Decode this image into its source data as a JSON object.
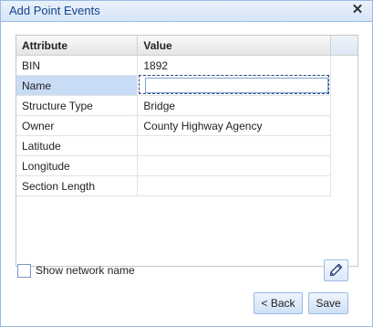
{
  "window": {
    "title": "Add Point Events",
    "close_glyph": "✕"
  },
  "grid": {
    "columns": [
      "Attribute",
      "Value"
    ],
    "rows": [
      {
        "attribute": "BIN",
        "value": "1892"
      },
      {
        "attribute": "Name",
        "value": ""
      },
      {
        "attribute": "Structure Type",
        "value": "Bridge"
      },
      {
        "attribute": "Owner",
        "value": "County Highway Agency"
      },
      {
        "attribute": "Latitude",
        "value": ""
      },
      {
        "attribute": "Longitude",
        "value": ""
      },
      {
        "attribute": "Section Length",
        "value": ""
      }
    ]
  },
  "options": {
    "show_network_name_label": "Show network name",
    "show_network_name_checked": false
  },
  "buttons": {
    "back": "< Back",
    "save": "Save"
  },
  "icons": {
    "edit": "pencil-icon",
    "close": "close-icon"
  },
  "colors": {
    "accent": "#15428b",
    "selected_row": "#c9dcf5",
    "border": "#99bbe8"
  }
}
